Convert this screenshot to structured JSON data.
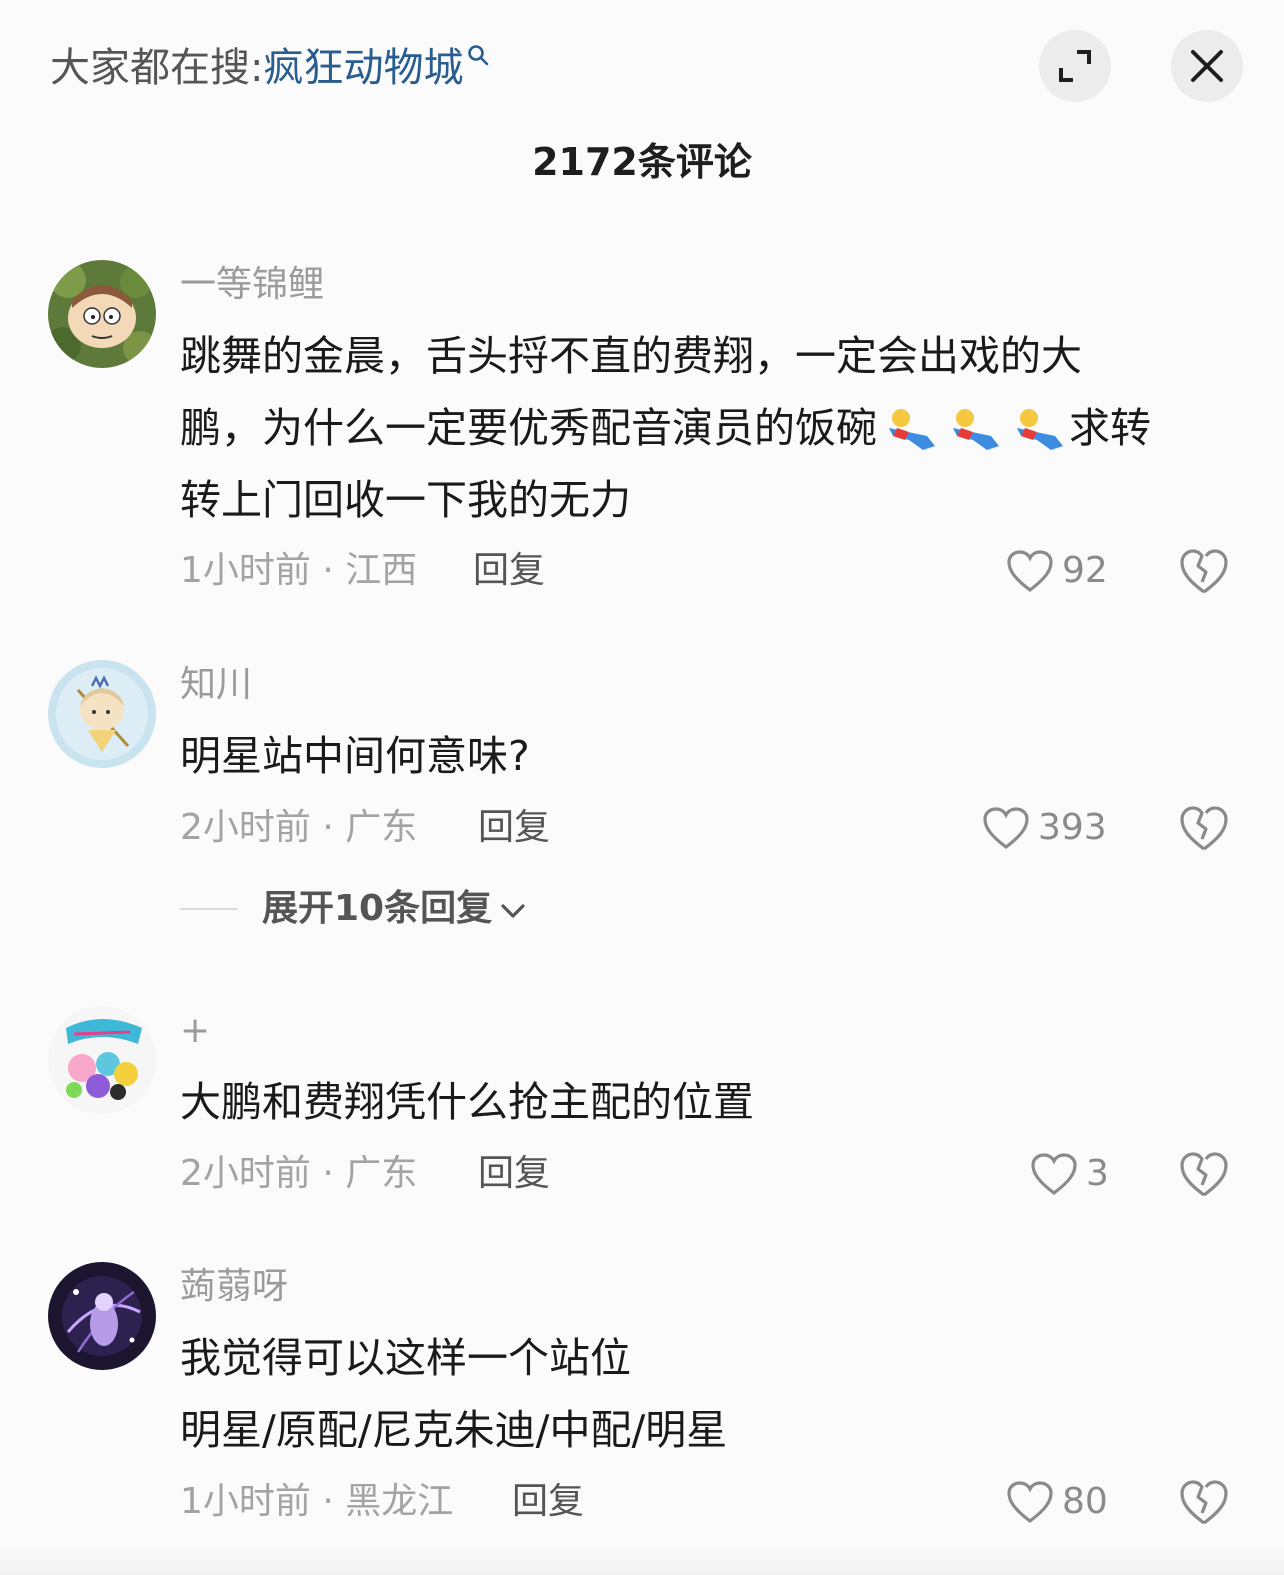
{
  "header": {
    "search_prefix": "大家都在搜:",
    "search_term": "疯狂动物城",
    "comment_count": "2172条评论"
  },
  "comments": [
    {
      "username": "一等锦鲤",
      "text_lines": [
        "跳舞的金晨，舌头捋不直的费翔，一定会出戏的大",
        "鹏，为什么一定要优秀配音演员的饭碗",
        "求转",
        "转上门回收一下我的无力"
      ],
      "meta": "1小时前 · 江西",
      "reply_label": "回复",
      "likes": "92"
    },
    {
      "username": "知川",
      "text_lines": [
        "明星站中间何意味?"
      ],
      "meta": "2小时前 · 广东",
      "reply_label": "回复",
      "likes": "393",
      "expand_replies": "展开10条回复"
    },
    {
      "username": "+",
      "text_lines": [
        "大鹏和费翔凭什么抢主配的位置"
      ],
      "meta": "2小时前 · 广东",
      "reply_label": "回复",
      "likes": "3"
    },
    {
      "username": "蒟蒻呀",
      "text_lines": [
        "我觉得可以这样一个站位",
        "明星/原配/尼克朱迪/中配/明星"
      ],
      "meta": "1小时前 · 黑龙江",
      "reply_label": "回复",
      "likes": "80"
    }
  ],
  "icons": {
    "expand": "expand-icon",
    "close": "close-icon",
    "like": "heart-icon",
    "dislike": "broken-heart-icon",
    "emoji": "lying-down-emoji"
  }
}
